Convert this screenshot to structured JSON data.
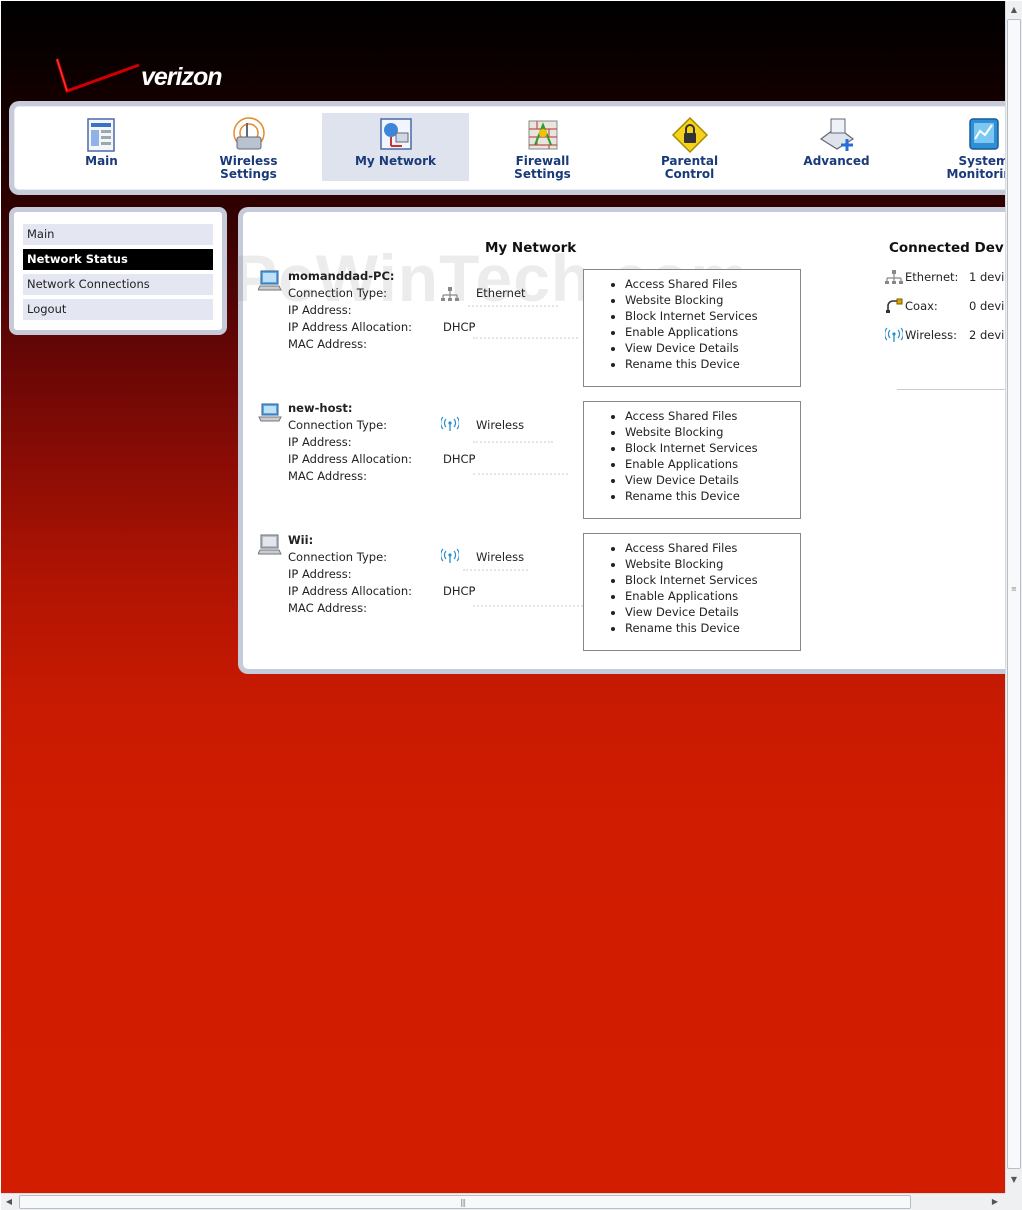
{
  "brand": {
    "name": "verizon",
    "accent": "#cc0000"
  },
  "top_nav": [
    {
      "label_1": "Main",
      "label_2": "",
      "icon": "main-page-icon"
    },
    {
      "label_1": "Wireless",
      "label_2": "Settings",
      "icon": "wireless-settings-icon"
    },
    {
      "label_1": "My Network",
      "label_2": "",
      "icon": "my-network-icon",
      "active": true
    },
    {
      "label_1": "Firewall",
      "label_2": "Settings",
      "icon": "firewall-icon"
    },
    {
      "label_1": "Parental",
      "label_2": "Control",
      "icon": "parental-lock-icon"
    },
    {
      "label_1": "Advanced",
      "label_2": "",
      "icon": "advanced-icon"
    },
    {
      "label_1": "System",
      "label_2": "Monitoring",
      "icon": "system-monitoring-icon"
    }
  ],
  "side_nav": [
    {
      "label": "Main"
    },
    {
      "label": "Network Status",
      "active": true
    },
    {
      "label": "Network Connections"
    },
    {
      "label": "Logout"
    }
  ],
  "main": {
    "title": "My Network",
    "watermark": "PcWinTech.com",
    "field_labels": {
      "connection_type": "Connection Type:",
      "ip_address": "IP Address:",
      "ip_allocation": "IP Address Allocation:",
      "mac_address": "MAC Address:"
    },
    "devices": [
      {
        "name": "momanddad-PC:",
        "connection_type": "Ethernet",
        "conn_icon": "ethernet-icon",
        "ip_allocation": "DHCP",
        "device_icon": "computer-icon"
      },
      {
        "name": "new-host:",
        "connection_type": "Wireless",
        "conn_icon": "wireless-signal-icon",
        "ip_allocation": "DHCP",
        "device_icon": "laptop-icon"
      },
      {
        "name": "Wii:",
        "connection_type": "Wireless",
        "conn_icon": "wireless-signal-icon",
        "ip_allocation": "DHCP",
        "device_icon": "computer-icon"
      }
    ],
    "actions": [
      "Access Shared Files",
      "Website Blocking",
      "Block Internet Services",
      "Enable Applications",
      "View Device Details",
      "Rename this Device"
    ]
  },
  "connected_devices": {
    "title": "Connected Dev",
    "rows": [
      {
        "label": "Ethernet:",
        "value": "1 devi",
        "icon": "ethernet-icon"
      },
      {
        "label": "Coax:",
        "value": "0 devi",
        "icon": "coax-icon"
      },
      {
        "label": "Wireless:",
        "value": "2 devi",
        "icon": "wireless-signal-icon"
      }
    ]
  }
}
